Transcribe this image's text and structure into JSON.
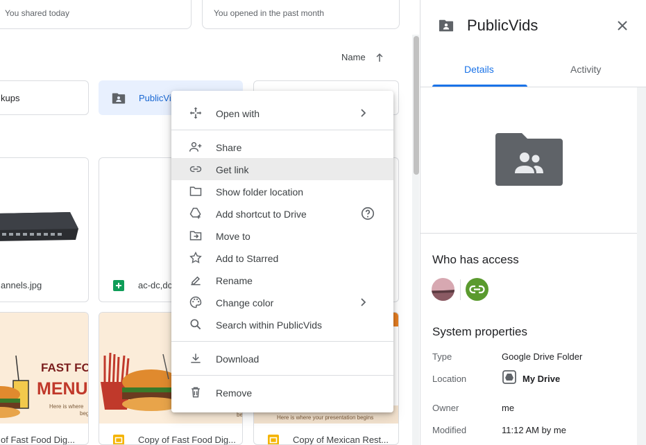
{
  "quick_access": [
    {
      "subtitle": "You shared today"
    },
    {
      "subtitle": "You opened in the past month"
    }
  ],
  "sort": {
    "label": "Name"
  },
  "folders": [
    {
      "name": "kups"
    },
    {
      "name": "PublicVi"
    }
  ],
  "files": [
    {
      "name": "annels.jpg"
    },
    {
      "name": "ac-dc,dc"
    },
    {
      "name": "of Fast Food Dig..."
    },
    {
      "name": "Copy of Fast Food Dig..."
    },
    {
      "name": "Copy of Mexican Rest..."
    }
  ],
  "thumb_text": {
    "fast_food": "FAST FOO",
    "menu": "MENU",
    "here": "Here is where",
    "begin": "beg",
    "bec": "be",
    "mexican_foot": "Here is where your presentation begins"
  },
  "menu": {
    "items": [
      {
        "label": "Open with"
      },
      {
        "label": "Share"
      },
      {
        "label": "Get link"
      },
      {
        "label": "Show folder location"
      },
      {
        "label": "Add shortcut to Drive"
      },
      {
        "label": "Move to"
      },
      {
        "label": "Add to Starred"
      },
      {
        "label": "Rename"
      },
      {
        "label": "Change color"
      },
      {
        "label": "Search within PublicVids"
      },
      {
        "label": "Download"
      },
      {
        "label": "Remove"
      }
    ]
  },
  "details": {
    "title": "PublicVids",
    "tabs": [
      {
        "label": "Details"
      },
      {
        "label": "Activity"
      }
    ],
    "who_has_access": "Who has access",
    "system_properties": "System properties",
    "props": [
      {
        "label": "Type",
        "value": "Google Drive Folder"
      },
      {
        "label": "Location",
        "value": "My Drive"
      },
      {
        "label": "Owner",
        "value": "me"
      },
      {
        "label": "Modified",
        "value": "11:12 AM by me"
      }
    ]
  },
  "colors": {
    "accent": "#1a73e8",
    "selected_bg": "#e8f0fe",
    "link_green": "#5a9a2e",
    "folder_gray": "#5f6368"
  }
}
